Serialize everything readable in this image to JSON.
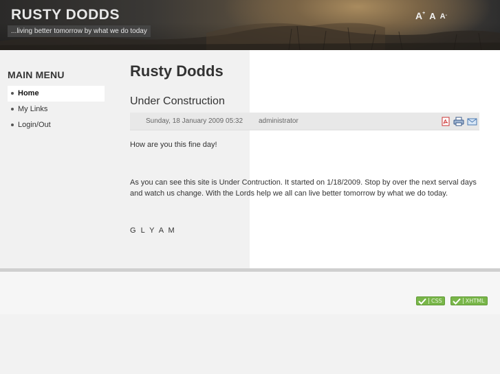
{
  "header": {
    "site_title": "RUSTY DODDS",
    "tagline": "...living better tomorrow by what we do today",
    "font_tools": {
      "larger": "A",
      "normal": "A",
      "smaller": "A",
      "larger_mark": "+",
      "smaller_mark": "-"
    }
  },
  "sidebar": {
    "title": "MAIN MENU",
    "items": [
      {
        "label": "Home",
        "active": true
      },
      {
        "label": "My Links",
        "active": false
      },
      {
        "label": "Login/Out",
        "active": false
      }
    ]
  },
  "main": {
    "page_heading": "Rusty Dodds",
    "article_title": "Under Construction",
    "meta": {
      "date": "Sunday, 18 January 2009 05:32",
      "author": "administrator"
    },
    "icons": [
      "pdf-icon",
      "print-icon",
      "email-icon"
    ],
    "paragraphs": [
      "How are you this fine day!",
      "As you can see this site is Under Contruction. It started on 1/18/2009.  Stop by over the next serval days and watch us change. With the Lords help we all can live better tomorrow by what we do today.",
      "G L Y A M"
    ]
  },
  "footer": {
    "badges": [
      "CSS",
      "XHTML"
    ],
    "badge_color": "#79b64a"
  }
}
